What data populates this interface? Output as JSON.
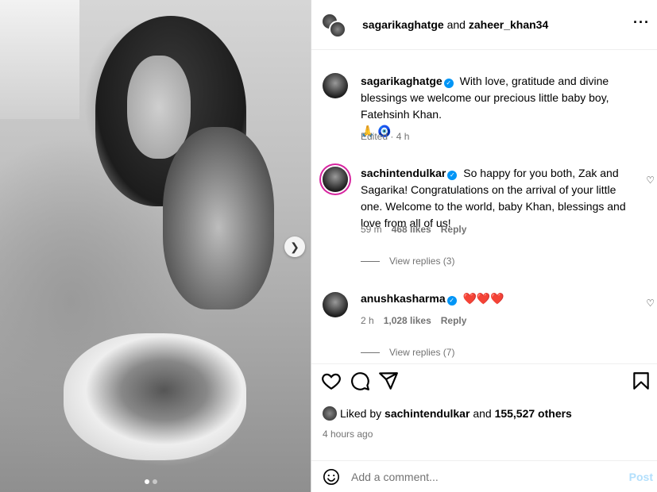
{
  "post": {
    "header": {
      "user1": "sagarikaghatge",
      "and": "and",
      "user2": "zaheer_khan34"
    },
    "caption": {
      "username": "sagarikaghatge",
      "text": "With love, gratitude and divine blessings we welcome our precious little baby boy, Fatehsinh Khan.",
      "emojis": "🙏 🧿",
      "meta": "Edited · 4 h"
    },
    "comments": [
      {
        "username": "sachintendulkar",
        "text": "So happy for you both, Zak and Sagarika! Congratulations on the arrival of your little one. Welcome to the world, baby Khan, blessings and love from all of us!",
        "time": "59 m",
        "likes": "468 likes",
        "reply": "Reply",
        "view_replies": "View replies (3)"
      },
      {
        "username": "anushkasharma",
        "text": "❤️❤️❤️",
        "time": "2 h",
        "likes": "1,028 likes",
        "reply": "Reply",
        "view_replies": "View replies (7)"
      }
    ],
    "liked_by": {
      "prefix": "Liked by",
      "user": "sachintendulkar",
      "and": "and",
      "others": "155,527 others"
    },
    "posted_time": "4 hours ago",
    "add_comment_placeholder": "Add a comment...",
    "post_button": "Post"
  },
  "icons": {
    "more": "more-horizontal-icon",
    "like": "heart-icon",
    "comment": "comment-icon",
    "share": "paper-plane-icon",
    "save": "bookmark-icon",
    "emoji": "smiley-icon",
    "next": "chevron-right-icon"
  },
  "colors": {
    "verified": "#0095f6",
    "secondary_text": "#737373",
    "post_button_disabled": "#b2dffc",
    "heart_emoji": "#e0102a"
  }
}
